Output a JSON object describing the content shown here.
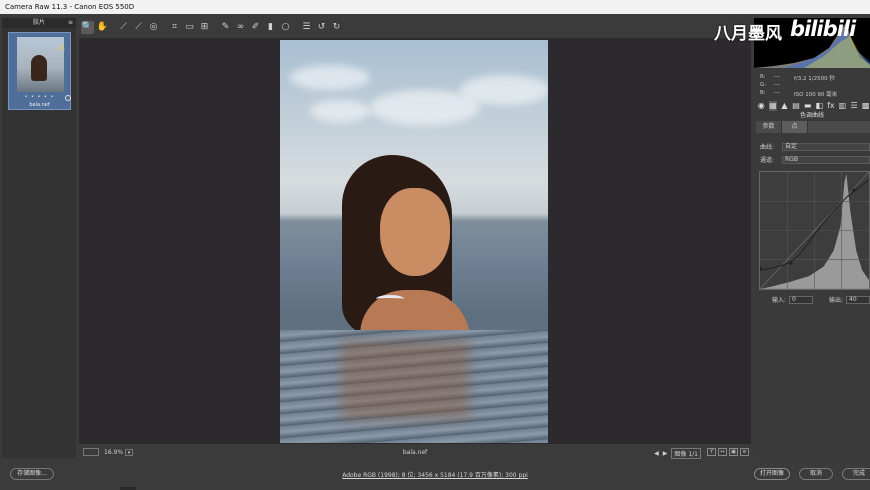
{
  "window": {
    "title": "Camera Raw 11.3 -  Canon EOS 550D"
  },
  "filmstrip": {
    "header": "胶片",
    "menu_icon": "menu-icon",
    "stars": "• • • • •",
    "filename": "bala.nef"
  },
  "toolbar": {
    "tools": [
      "zoom-icon",
      "hand-icon",
      "white-balance-icon",
      "color-sampler-icon",
      "targeted-adjust-icon",
      "crop-icon",
      "straighten-icon",
      "transform-icon",
      "spot-removal-icon",
      "red-eye-icon",
      "adjustment-brush-icon",
      "graduated-filter-icon",
      "radial-filter-icon",
      "preferences-icon",
      "rotate-ccw-icon",
      "rotate-cw-icon"
    ]
  },
  "canvas": {
    "zoom": "16.9%",
    "filename": "bala.nef",
    "image_label": "图像 1/1"
  },
  "info": {
    "rows": [
      {
        "lbl": "R:",
        "val": "f/3.2   1/2500 秒"
      },
      {
        "lbl": "G:",
        "val": ""
      },
      {
        "lbl": "B:",
        "val": "ISO 100   90 毫米"
      }
    ]
  },
  "panel": {
    "section_title": "色调曲线",
    "subtab1": "参数",
    "subtab2": "点",
    "curve_label": "曲线:",
    "curve_value": "自定",
    "channel_label": "通道:",
    "channel_value": "RGB",
    "input_label": "输入:",
    "input_value": "0",
    "output_label": "输出:",
    "output_value": "40"
  },
  "watermark": {
    "text": "八月墨风",
    "brand": "bilibili"
  },
  "bottom": {
    "save_label": "存储图像...",
    "workflow": "Adobe RGB (1998); 8 位; 3456 x 5184 (17.9 百万像素); 300 ppi",
    "open_label": "打开图像",
    "cancel_label": "取消",
    "done_label": "完成"
  }
}
